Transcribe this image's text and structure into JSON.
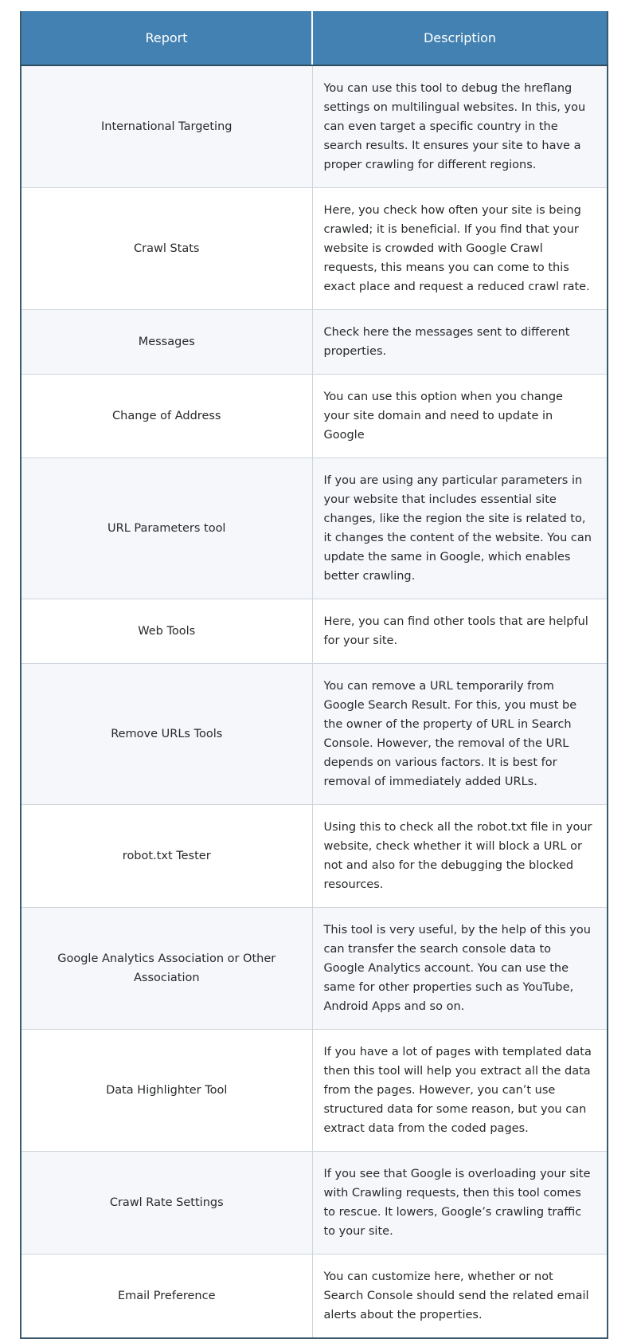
{
  "table": {
    "columns": [
      {
        "key": "report",
        "label": "Report"
      },
      {
        "key": "description",
        "label": "Description"
      }
    ],
    "header_background": "#4281b1",
    "header_text_color": "#ffffff",
    "stripe_color": "#f5f7fb",
    "border_color": "#3a5a6e",
    "rows": [
      {
        "report": "International Targeting",
        "description": "You can use this tool to debug the hreflang settings on multilingual websites. In this, you can even target a specific country in the search results. It ensures your site to have a proper crawling for different regions."
      },
      {
        "report": "Crawl Stats",
        "description": "Here, you check how often your site is being crawled; it is beneficial. If you find that your website is crowded with Google Crawl requests, this means you can come to this exact place and request a reduced crawl rate."
      },
      {
        "report": "Messages",
        "description": "Check here the messages sent to different properties."
      },
      {
        "report": "Change of Address",
        "description": "You can use this option when you change your site domain and need to update in Google"
      },
      {
        "report": "URL Parameters tool",
        "description": "If you are using any particular parameters in your website that includes essential site changes, like the region the site is related to, it changes the content of the website. You can update the same in Google, which enables better crawling."
      },
      {
        "report": "Web Tools",
        "description": "Here, you can find other tools that are helpful for your site."
      },
      {
        "report": "Remove URLs Tools",
        "description": "You can remove a URL temporarily from Google Search Result. For this, you must be the owner of the property of URL in Search Console. However, the removal of the URL depends on various factors. It is best for removal of immediately added URLs."
      },
      {
        "report": "robot.txt Tester",
        "description": "Using this to check all the robot.txt file in your website, check whether it will block a URL or not and also for the debugging the blocked resources."
      },
      {
        "report": "Google Analytics Association or Other Association",
        "description": "This tool is very useful, by the help of this you can transfer the search console data to Google Analytics account. You can use the same for other properties such as YouTube, Android Apps and so on."
      },
      {
        "report": "Data Highlighter Tool",
        "description": "If you have a lot of pages with templated data then this tool will help you extract all the data from the pages. However, you can’t use structured data for some reason, but you can extract data from the coded pages."
      },
      {
        "report": "Crawl Rate Settings",
        "description": "If you see that Google is overloading your site with Crawling requests, then this tool comes to rescue. It lowers, Google’s crawling traffic to your site."
      },
      {
        "report": "Email Preference",
        "description": "You can customize here, whether or not Search Console should send the related email alerts about the properties."
      }
    ]
  }
}
